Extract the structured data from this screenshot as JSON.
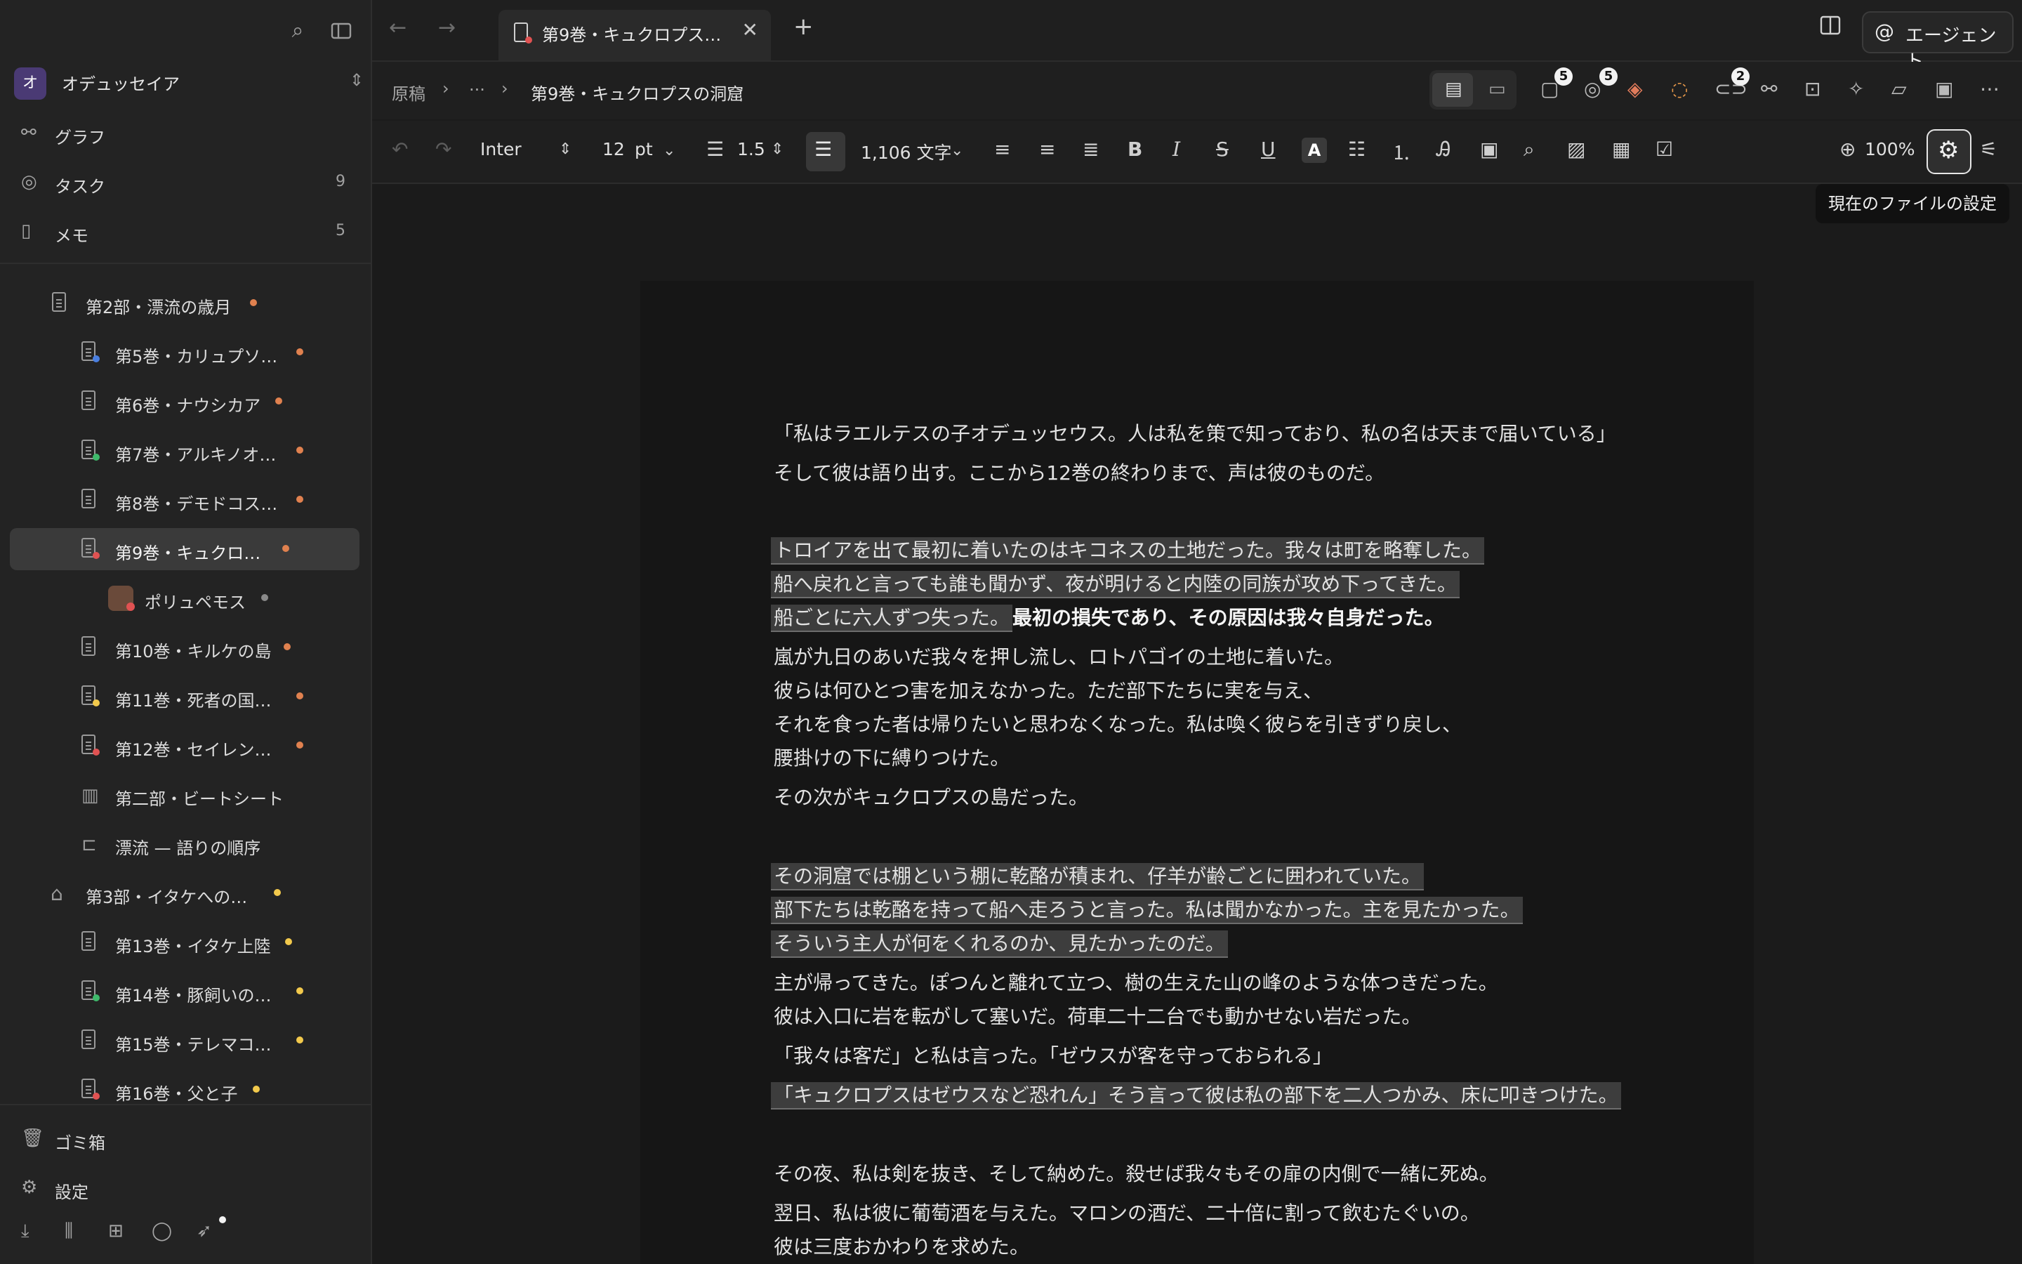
{
  "workspace": {
    "avatar": "オ",
    "name": "オデュッセイア"
  },
  "nav": [
    {
      "label": "グラフ",
      "count": ""
    },
    {
      "label": "タスク",
      "count": "9"
    },
    {
      "label": "メモ",
      "count": "5"
    }
  ],
  "tree": [
    {
      "label": "第2部・漂流の歳月"
    },
    {
      "label": "第5巻・カリュプソ…"
    },
    {
      "label": "第6巻・ナウシカア"
    },
    {
      "label": "第7巻・アルキノオ…"
    },
    {
      "label": "第8巻・デモドコス…"
    },
    {
      "label": "第9巻・キュクロ…"
    },
    {
      "label": "ポリュペモス"
    },
    {
      "label": "第10巻・キルケの島"
    },
    {
      "label": "第11巻・死者の国…"
    },
    {
      "label": "第12巻・セイレン…"
    },
    {
      "label": "第二部・ビートシート"
    },
    {
      "label": "漂流 — 語りの順序"
    },
    {
      "label": "第3部・イタケへの…"
    },
    {
      "label": "第13巻・イタケ上陸"
    },
    {
      "label": "第14巻・豚飼いの…"
    },
    {
      "label": "第15巻・テレマコ…"
    },
    {
      "label": "第16巻・父と子"
    }
  ],
  "sidebar_bottom": {
    "trash": "ゴミ箱",
    "settings": "設定"
  },
  "tab": {
    "title": "第9巻・キュクロプス…"
  },
  "agent_label": "エージェント",
  "breadcrumb": {
    "root": "原稿",
    "ellipsis": "···",
    "current": "第9巻・キュクロプスの洞窟"
  },
  "badges": {
    "files": "5",
    "tasks": "5",
    "links": "2"
  },
  "toolbar": {
    "font": "Inter",
    "size": "12",
    "unit": "pt",
    "line_height": "1.5",
    "word_count": "1,106 文字",
    "zoom": "100%"
  },
  "tooltip": "現在のファイルの設定",
  "colors": {
    "dot_orange": "#e0814f",
    "dot_yellow": "#f2c94c",
    "dot_gray": "#8a8a8a",
    "badge_blue": "#4a7fe0",
    "badge_green": "#3fb96b",
    "badge_red": "#e05252",
    "badge_yellow": "#f2c94c"
  },
  "doc": {
    "l1": "「私はラエルテスの子オデュッセウス。人は私を策で知っており、私の名は天まで届いている」",
    "l2": "そして彼は語り出す。ここから12巻の終わりまで、声は彼のものだ。",
    "l3": "トロイアを出て最初に着いたのはキコネスの土地だった。我々は町を略奪した。",
    "l4": "船へ戻れと言っても誰も聞かず、夜が明けると内陸の同族が攻め下ってきた。",
    "l5a": "船ごとに六人ずつ失った。",
    "l5b": "最初の損失であり、その原因は我々自身だった。",
    "l6": "嵐が九日のあいだ我々を押し流し、ロトパゴイの土地に着いた。",
    "l7": "彼らは何ひとつ害を加えなかった。ただ部下たちに実を与え、",
    "l8": "それを食った者は帰りたいと思わなくなった。私は喚く彼らを引きずり戻し、",
    "l9": "腰掛けの下に縛りつけた。",
    "l10": "その次がキュクロプスの島だった。",
    "l11": "その洞窟では棚という棚に乾酪が積まれ、仔羊が齢ごとに囲われていた。",
    "l12": "部下たちは乾酪を持って船へ走ろうと言った。私は聞かなかった。主を見たかった。",
    "l13": "そういう主人が何をくれるのか、見たかったのだ。",
    "l14": "主が帰ってきた。ぽつんと離れて立つ、樹の生えた山の峰のような体つきだった。",
    "l15": "彼は入口に岩を転がして塞いだ。荷車二十二台でも動かせない岩だった。",
    "l16": "「我々は客だ」と私は言った。「ゼウスが客を守っておられる」",
    "l17": "「キュクロプスはゼウスなど恐れん」そう言って彼は私の部下を二人つかみ、床に叩きつけた。",
    "l18": "その夜、私は剣を抜き、そして納めた。殺せば我々もその扉の内側で一緒に死ぬ。",
    "l19": "翌日、私は彼に葡萄酒を与えた。マロンの酒だ、二十倍に割って飲むたぐいの。",
    "l20": "彼は三度おかわりを求めた。"
  }
}
